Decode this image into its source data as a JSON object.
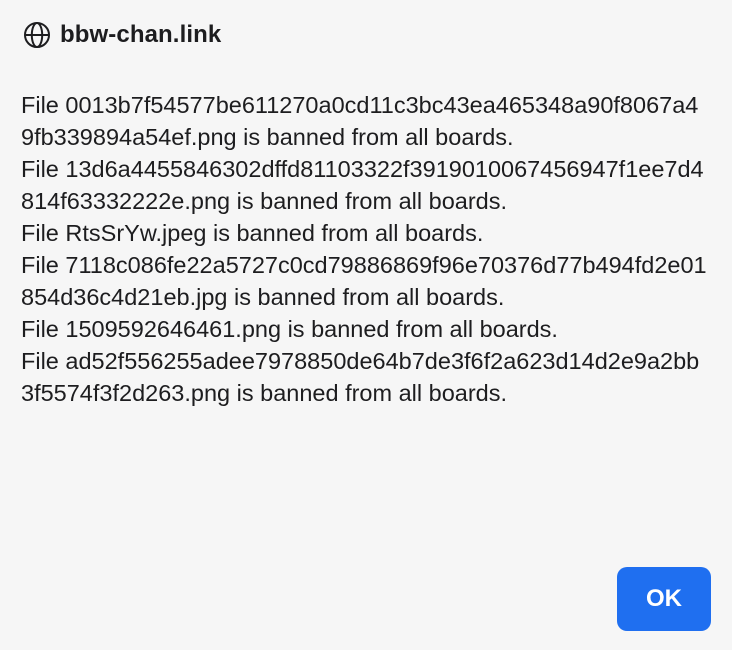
{
  "dialog": {
    "site": "bbw-chan.link",
    "icon": "globe-icon",
    "messages": [
      "File 0013b7f54577be611270a0cd11c3bc43ea465348a90f8067a49fb339894a54ef.png is banned from all boards.",
      "File 13d6a4455846302dffd81103322f3919010067456947f1ee7d4814f63332222e.png is banned from all boards.",
      "File RtsSrYw.jpeg is banned from all boards.",
      "File 7118c086fe22a5727c0cd79886869f96e70376d77b494fd2e01854d36c4d21eb.jpg is banned from all boards.",
      "File 1509592646461.png is banned from all boards.",
      "File ad52f556255adee7978850de64b7de3f6f2a623d14d2e9a2bb3f5574f3f2d263.png is banned from all boards."
    ],
    "ok_label": "OK"
  },
  "colors": {
    "background": "#f6f6f6",
    "text": "#1d1d1f",
    "accent": "#1f6ff0"
  }
}
